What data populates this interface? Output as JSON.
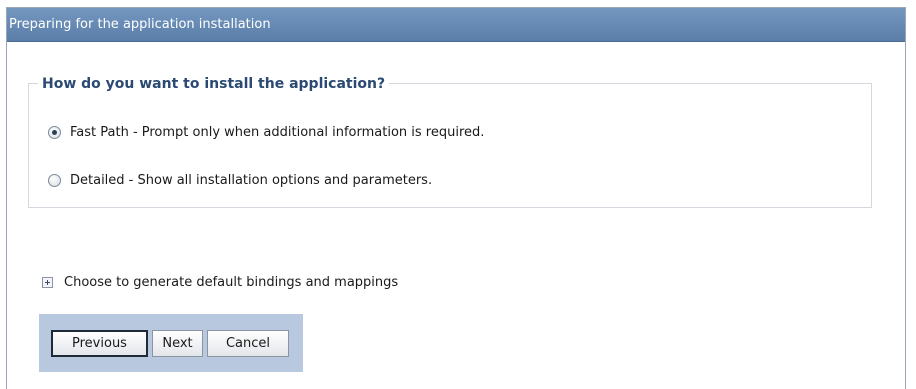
{
  "window": {
    "title": "Preparing for the application installation"
  },
  "install_method": {
    "legend": "How do you want to install the application?",
    "options": [
      {
        "label": "Fast Path - Prompt only when additional information is required.",
        "selected": true
      },
      {
        "label": "Detailed - Show all installation options and parameters.",
        "selected": false
      }
    ]
  },
  "bindings_section": {
    "label": "Choose to generate default bindings and mappings",
    "expanded": false
  },
  "buttons": {
    "previous_label": "Previous",
    "next_label": "Next",
    "cancel_label": "Cancel"
  },
  "colors": {
    "titlebar": "#6a8db6",
    "legend_text": "#2a4a73",
    "button_bar": "#b8c8de"
  }
}
